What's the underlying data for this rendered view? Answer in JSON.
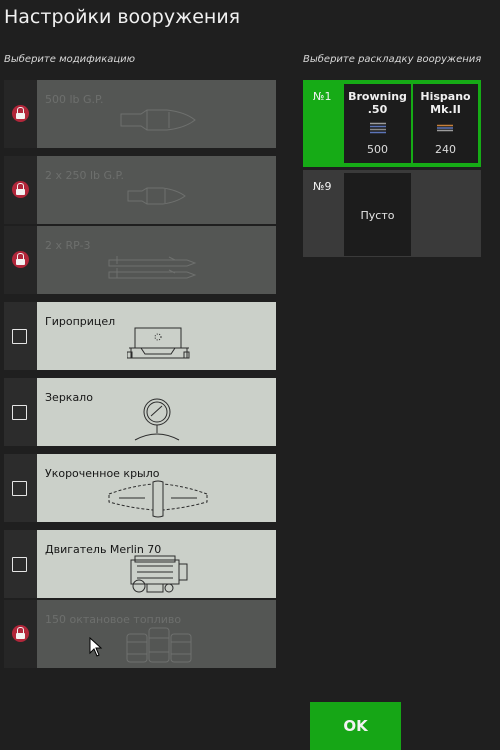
{
  "header": {
    "title": "Настройки вооружения"
  },
  "modifications": {
    "heading": "Выберите модификацию",
    "items": [
      {
        "label": "500 lb G.P.",
        "locked": true,
        "icon": "bomb-icon"
      },
      {
        "label": "2 x 250 lb G.P.",
        "locked": true,
        "icon": "bomb-icon"
      },
      {
        "label": "2 x RP-3",
        "locked": true,
        "icon": "rocket-icon"
      },
      {
        "label": "Гироприцел",
        "locked": false,
        "icon": "gyro-sight-icon"
      },
      {
        "label": "Зеркало",
        "locked": false,
        "icon": "mirror-icon"
      },
      {
        "label": "Укороченное крыло",
        "locked": false,
        "icon": "clipped-wing-icon"
      },
      {
        "label": "Двигатель Merlin 70",
        "locked": false,
        "icon": "engine-icon"
      },
      {
        "label": "150 октановое топливо",
        "locked": true,
        "icon": "fuel-barrels-icon"
      }
    ]
  },
  "loadouts": {
    "heading": "Выберите раскладку вооружения",
    "items": [
      {
        "number": "№1",
        "selected": true,
        "weapons": [
          {
            "name": "Browning .50",
            "ammo": "500",
            "icon": "ammo-belt-icon"
          },
          {
            "name": "Hispano Mk.II",
            "ammo": "240",
            "icon": "ammo-belt-icon"
          }
        ]
      },
      {
        "number": "№9",
        "selected": false,
        "empty_label": "Пусто"
      }
    ]
  },
  "footer": {
    "ok_label": "OK"
  },
  "colors": {
    "accent_green": "#16ab16",
    "lock_red": "#b1263a",
    "card_light": "#cbd0c9",
    "card_locked": "#545654"
  }
}
